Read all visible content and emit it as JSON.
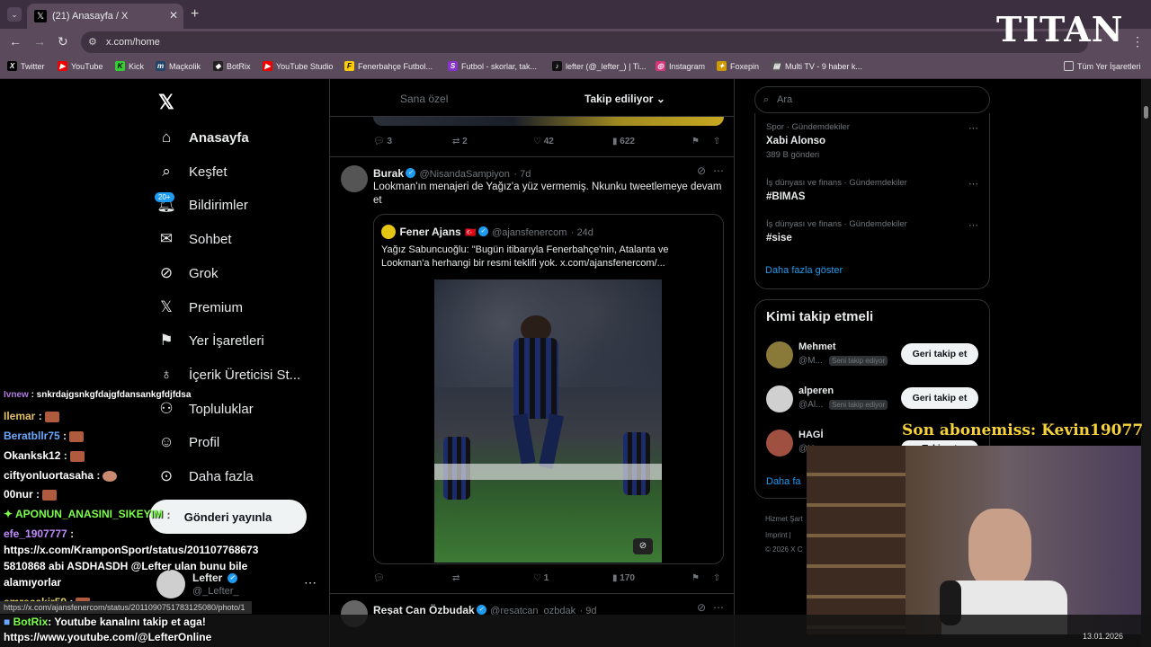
{
  "browser": {
    "tab_title": "(21) Anasayfa / X",
    "url": "x.com/home",
    "bookmarks": [
      "Twitter",
      "YouTube",
      "Kick",
      "Maçkolik",
      "BotRix",
      "YouTube Studio",
      "Fenerbahçe Futbol...",
      "Futbol - skorlar, tak...",
      "lefter (@_lefter_) | Ti...",
      "Instagram",
      "Foxepin",
      "Multi TV - 9 haber k..."
    ],
    "bookmarks_folder": "Tüm Yer İşaretleri"
  },
  "nav": {
    "items": [
      {
        "label": "Anasayfa",
        "icon": "home-icon"
      },
      {
        "label": "Keşfet",
        "icon": "search-icon"
      },
      {
        "label": "Bildirimler",
        "icon": "bell-icon"
      },
      {
        "label": "Sohbet",
        "icon": "mail-icon"
      },
      {
        "label": "Grok",
        "icon": "grok-icon"
      },
      {
        "label": "Premium",
        "icon": "x-icon"
      },
      {
        "label": "Yer İşaretleri",
        "icon": "bookmark-icon"
      },
      {
        "label": "İçerik Üreticisi St...",
        "icon": "creator-icon"
      },
      {
        "label": "Topluluklar",
        "icon": "communities-icon"
      },
      {
        "label": "Profil",
        "icon": "profile-icon"
      },
      {
        "label": "Daha fazla",
        "icon": "more-icon"
      }
    ],
    "notif_badge": "20+",
    "post_button": "Gönderi yayınla",
    "account_name": "Lefter",
    "account_handle": "@_Lefter_"
  },
  "feed": {
    "tabs": [
      "Sana özel",
      "Takip ediliyor"
    ],
    "prev_stats": {
      "replies": "3",
      "reposts": "2",
      "likes": "42",
      "views": "622"
    },
    "tweet1": {
      "name": "Burak",
      "handle": "@NisandaSampiyon",
      "time": "· 7d",
      "text": "Lookman'ın menajeri de Yağız'a yüz vermemiş. Nkunku tweetlemeye devam et",
      "quote": {
        "name": "Fener Ajans",
        "handle": "@ajansfenercom",
        "time": "· 24d",
        "text": "Yağız Sabuncuoğlu: \"Bugün itibarıyla Fenerbahçe'nin, Atalanta ve Lookman'a herhangi bir resmi teklifi yok.  x.com/ajansfenercom/..."
      },
      "stats": {
        "replies": "",
        "reposts": "",
        "likes": "1",
        "views": "170"
      }
    },
    "tweet2": {
      "name": "Reşat Can Özbudak",
      "handle": "@resatcan_ozbdak",
      "time": "· 9d"
    }
  },
  "right": {
    "search_placeholder": "Ara",
    "trends": [
      {
        "category": "Spor · Gündemdekiler",
        "name": "Xabi Alonso",
        "posts": "389 B gönderi"
      },
      {
        "category": "İş dünyası ve finans · Gündemdekiler",
        "name": "#BIMAS",
        "posts": ""
      },
      {
        "category": "İş dünyası ve finans · Gündemdekiler",
        "name": "#sise",
        "posts": ""
      }
    ],
    "show_more": "Daha fazla göster",
    "who_to_follow_title": "Kimi takip etmeli",
    "follow": [
      {
        "name": "Mehmet",
        "handle": "@M...",
        "badge": "Seni takip ediyor",
        "button": "Geri takip et"
      },
      {
        "name": "alperen",
        "handle": "@Al...",
        "badge": "Seni takip ediyor",
        "button": "Geri takip et"
      },
      {
        "name": "HAGİ",
        "handle": "@Ha...",
        "badge": "",
        "button": "Takip et"
      }
    ],
    "wtf_more": "Daha fa",
    "footer": [
      "Hizmet Şart",
      "Imprint  |",
      "© 2026 X C"
    ]
  },
  "overlay": {
    "logo": "TITAN",
    "sub_alert": "Son abonemiss: Kevin19077",
    "status_url": "https://x.com/ajansfenercom/status/2011090751783125080/photo/1",
    "clock": "13.01.2026"
  },
  "chat": [
    {
      "user": "Ivnew",
      "text": " : snkrdajgsnkgfdajgfdansankgfdjfdsa",
      "color": "#b07ae0"
    },
    {
      "user": "Ilemar",
      "text": " :",
      "color": "#e0c060"
    },
    {
      "user": "Beratbllr75",
      "text": " :",
      "color": "#69a8ff"
    },
    {
      "user": "Okanksk12",
      "text": " :",
      "color": "#ffffff"
    },
    {
      "user": "ciftyonluortasaha",
      "text": " :",
      "color": "#ffffff"
    },
    {
      "user": "00nur",
      "text": " :",
      "color": "#ffffff"
    },
    {
      "user": "APONUN_ANASINI_SIKEYIM",
      "text": " :",
      "color": "#7cff4a"
    },
    {
      "user": "efe_1907777",
      "text": " :",
      "color": "#c08aff"
    },
    {
      "user": "",
      "text": "https://x.com/KramponSport/status/201107768673",
      "color": "#ffffff"
    },
    {
      "user": "",
      "text": "5810868 abi ASDHASDH @Lefter ulan bunu bile",
      "color": "#ffffff"
    },
    {
      "user": "",
      "text": "alamıyorlar",
      "color": "#ffffff"
    },
    {
      "user": "emrecakir59",
      "text": " :",
      "color": "#e0d060"
    },
    {
      "user": "BotRix",
      "text": ": Youtube kanalını takip et aga!",
      "color": "#7cff4a"
    },
    {
      "user": "",
      "text": "https://www.youtube.com/@LefterOnline",
      "color": "#ffffff"
    }
  ]
}
